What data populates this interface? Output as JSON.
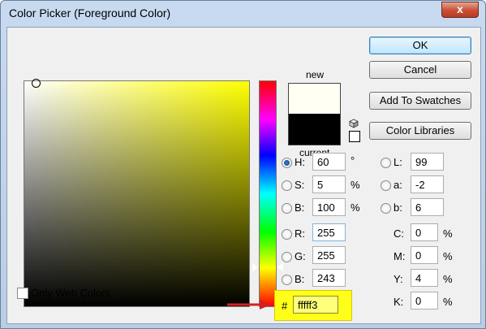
{
  "window": {
    "title": "Color Picker (Foreground Color)",
    "close_label": "x"
  },
  "preview": {
    "new_label": "new",
    "current_label": "current",
    "new_color": "#fffff3",
    "current_color": "#000000"
  },
  "buttons": {
    "ok": "OK",
    "cancel": "Cancel",
    "add_to_swatches": "Add To Swatches",
    "color_libraries": "Color Libraries"
  },
  "hsb": {
    "h": {
      "label": "H:",
      "value": "60",
      "unit": "°",
      "checked": true
    },
    "s": {
      "label": "S:",
      "value": "5",
      "unit": "%"
    },
    "b": {
      "label": "B:",
      "value": "100",
      "unit": "%"
    }
  },
  "rgb": {
    "r": {
      "label": "R:",
      "value": "255"
    },
    "g": {
      "label": "G:",
      "value": "255"
    },
    "b": {
      "label": "B:",
      "value": "243"
    }
  },
  "lab": {
    "l": {
      "label": "L:",
      "value": "99"
    },
    "a": {
      "label": "a:",
      "value": "-2"
    },
    "b": {
      "label": "b:",
      "value": "6"
    }
  },
  "cmyk": {
    "c": {
      "label": "C:",
      "value": "0",
      "unit": "%"
    },
    "m": {
      "label": "M:",
      "value": "0",
      "unit": "%"
    },
    "y": {
      "label": "Y:",
      "value": "4",
      "unit": "%"
    },
    "k": {
      "label": "K:",
      "value": "0",
      "unit": "%"
    }
  },
  "hex": {
    "hash": "#",
    "value": "fffff3"
  },
  "only_web_colors": {
    "label": "Only Web Colors",
    "checked": false
  },
  "colors": {
    "highlight": "#ffff1a",
    "arrow": "#d42020",
    "hue_selected": "#ffff00"
  }
}
